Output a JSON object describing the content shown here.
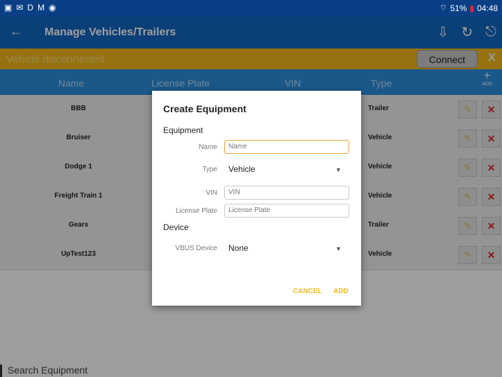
{
  "statusbar": {
    "left_icons": [
      "image-icon",
      "mail-icon",
      "D",
      "M",
      "shield-icon"
    ],
    "battery": "51%",
    "time": "04:48"
  },
  "appbar": {
    "back_glyph": "←",
    "title": "Manage Vehicles/Trailers"
  },
  "banner": {
    "text": "Vehicle disconnected",
    "connect_label": "Connect",
    "close_label": "X",
    "bg_color": "#f3b91a"
  },
  "table": {
    "headers": [
      "Name",
      "License Plate",
      "VIN",
      "Type"
    ],
    "add_label": "ADD",
    "rows": [
      {
        "name": "BBB",
        "type": "Trailer"
      },
      {
        "name": "Bruiser",
        "type": "Vehicle"
      },
      {
        "name": "Dodge 1",
        "type": "Vehicle"
      },
      {
        "name": "Freight Train 1",
        "type": "Vehicle"
      },
      {
        "name": "Gears",
        "type": "Trailer"
      },
      {
        "name": "UpTest123",
        "type": "Vehicle"
      }
    ]
  },
  "search": {
    "placeholder": "Search Equipment"
  },
  "dialog": {
    "title": "Create Equipment",
    "section_equipment": "Equipment",
    "name_label": "Name",
    "name_placeholder": "Name",
    "type_label": "Type",
    "type_value": "Vehicle",
    "vin_label": "VIN",
    "vin_placeholder": "VIN",
    "plate_label": "License Plate",
    "plate_placeholder": "License Plate",
    "section_device": "Device",
    "device_label": "VBUS Device",
    "device_value": "None",
    "cancel_label": "CANCEL",
    "add_label": "ADD"
  }
}
